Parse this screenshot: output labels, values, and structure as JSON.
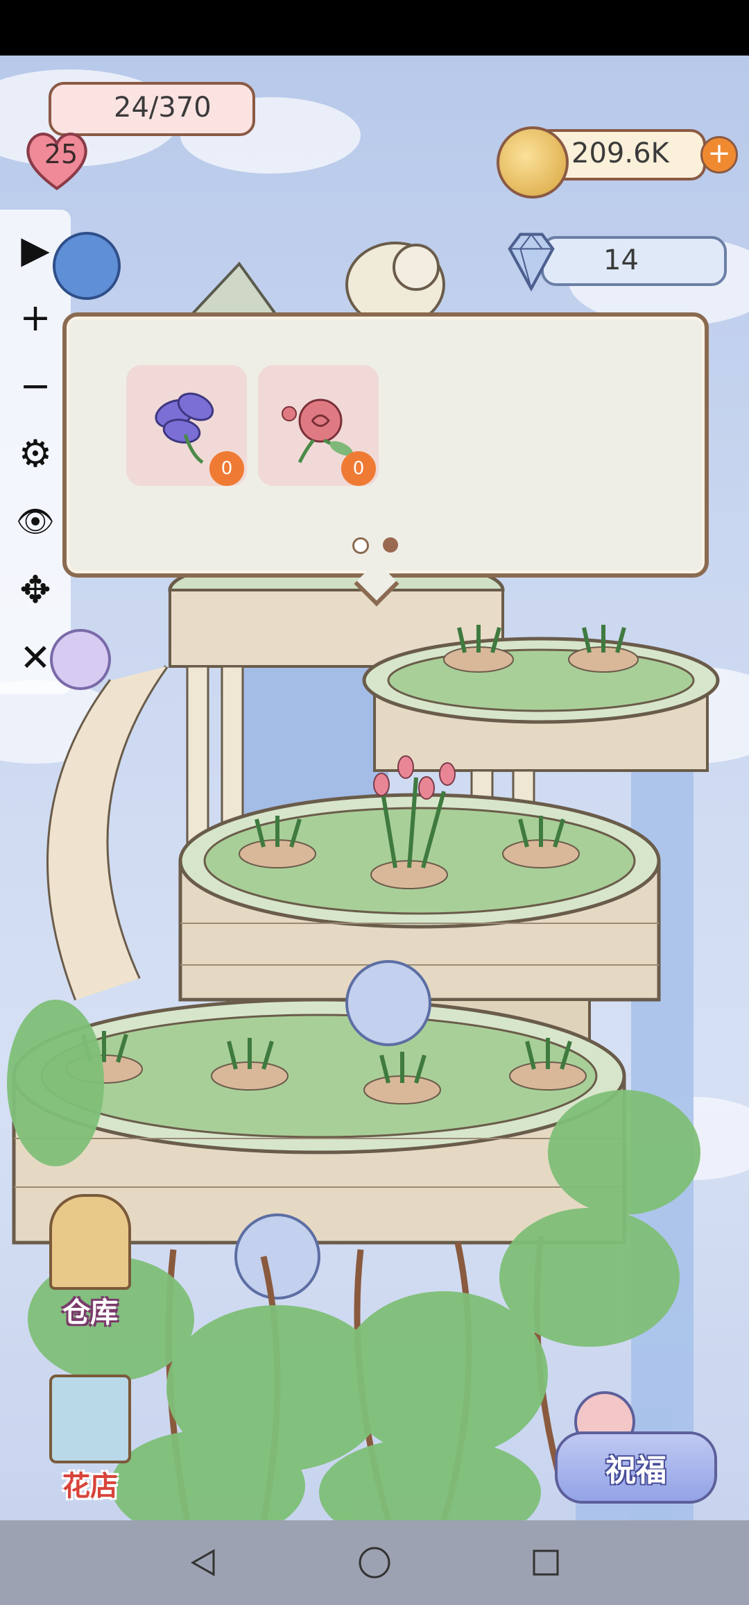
{
  "hud": {
    "level": "25",
    "lives": "24/370",
    "coins": "209.6K",
    "gems": "14"
  },
  "toolbar": {
    "items": [
      {
        "name": "play",
        "glyph": "▶"
      },
      {
        "name": "zoom-in",
        "glyph": "+"
      },
      {
        "name": "zoom-out",
        "glyph": "−"
      },
      {
        "name": "settings",
        "glyph": "⚙"
      },
      {
        "name": "visibility",
        "glyph": "👁"
      },
      {
        "name": "move",
        "glyph": "✥"
      },
      {
        "name": "close",
        "glyph": "✕"
      }
    ]
  },
  "panel": {
    "items": [
      {
        "name": "purple-iris",
        "count": "0"
      },
      {
        "name": "red-rose",
        "count": "0"
      }
    ],
    "pages": 2,
    "active_page": 2
  },
  "buttons": {
    "warehouse": "仓库",
    "flower_shop": "花店",
    "blessing": "祝福"
  },
  "colors": {
    "badge": "#ef7a34",
    "panel_border": "#8a6a50",
    "lives_pill": "#fbe3e2",
    "coin_pill": "#fbf0d9",
    "gem_pill": "#dfe9f8"
  }
}
